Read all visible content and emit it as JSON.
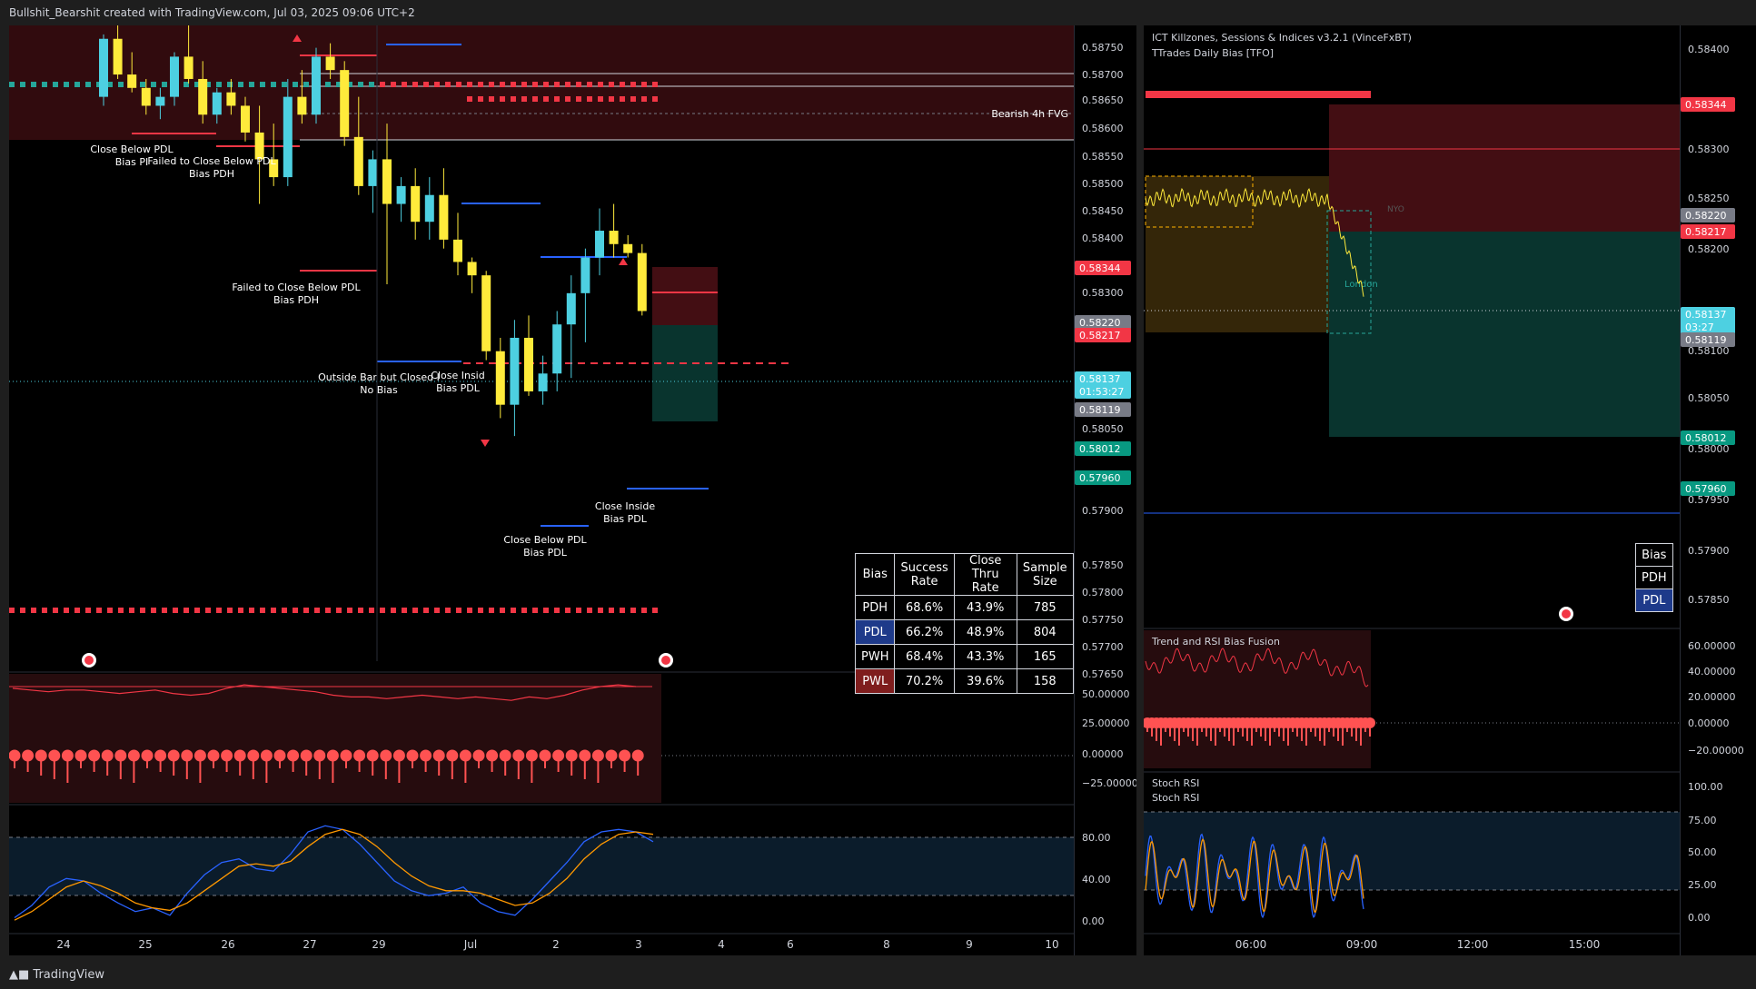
{
  "header": {
    "attribution": "Bullshit_Bearshit created with TradingView.com, Jul 03, 2025 09:06 UTC+2"
  },
  "footer": {
    "brand": "TradingView"
  },
  "colors": {
    "bull": "#4dd0e1",
    "bear": "#ffeb3b",
    "red": "#f44336",
    "green": "#089981",
    "blue": "#2962ff",
    "orange": "#ff9800"
  },
  "left_chart": {
    "price_labels": [
      "0.58750",
      "0.58700",
      "0.58650",
      "0.58600",
      "0.58550",
      "0.58500",
      "0.58450",
      "0.58400",
      "0.58300",
      "0.58050",
      "0.57900",
      "0.57850",
      "0.57800",
      "0.57750",
      "0.57700",
      "0.57650"
    ],
    "price_badges": [
      {
        "text": "0.58344",
        "color": "#f23645"
      },
      {
        "text": "0.58220",
        "color": "#787b86"
      },
      {
        "text": "0.58217",
        "color": "#f23645"
      },
      {
        "text": "0.58137",
        "text2": "01:53:27",
        "color": "#4dd0e1"
      },
      {
        "text": "0.58119",
        "color": "#787b86"
      },
      {
        "text": "0.58012",
        "color": "#089981"
      },
      {
        "text": "0.57960",
        "color": "#089981"
      }
    ],
    "time_labels": [
      "24",
      "25",
      "26",
      "27",
      "29",
      "Jul",
      "2",
      "3",
      "4",
      "6",
      "8",
      "9",
      "10"
    ],
    "annotations": [
      {
        "line1": "Close Below PDL",
        "line2": "Bias PI"
      },
      {
        "line1": "Failed to Close Below PDL",
        "line2": "Bias PDH"
      },
      {
        "line1": "Failed to Close Below PDL",
        "line2": "Bias PDH"
      },
      {
        "line1": "Outside Bar but Closed I",
        "line2": "No Bias"
      },
      {
        "line1": "Close Insid",
        "line2": "Bias PDL"
      },
      {
        "line1": "Close Below PDL",
        "line2": "Bias PDL"
      },
      {
        "line1": "Close Inside",
        "line2": "Bias PDL"
      }
    ],
    "fvg_label": "Bearish 4h FVG",
    "osc1_labels": [
      "50.00000",
      "25.00000",
      "0.00000",
      "−25.00000"
    ],
    "osc2_labels": [
      "80.00",
      "40.00",
      "0.00"
    ]
  },
  "stats_table": {
    "headers": [
      "Bias",
      "Success Rate",
      "Close Thru Rate",
      "Sample Size"
    ],
    "rows": [
      {
        "bias": "PDH",
        "success": "68.6%",
        "close_thru": "43.9%",
        "size": "785",
        "bg": "#000000"
      },
      {
        "bias": "PDL",
        "success": "66.2%",
        "close_thru": "48.9%",
        "size": "804",
        "bg": "#1e3a8a"
      },
      {
        "bias": "PWH",
        "success": "68.4%",
        "close_thru": "43.3%",
        "size": "165",
        "bg": "#000000"
      },
      {
        "bias": "PWL",
        "success": "70.2%",
        "close_thru": "39.6%",
        "size": "158",
        "bg": "#7f1d1d"
      }
    ]
  },
  "right_chart": {
    "legend": [
      "ICT Killzones, Sessions & Indices v3.2.1 (VinceFxBT)",
      "TTrades Daily Bias [TFO]"
    ],
    "price_labels": [
      "0.58400",
      "0.58300",
      "0.58250",
      "0.58200",
      "0.58100",
      "0.58050",
      "0.58000",
      "0.57950",
      "0.57900",
      "0.57850"
    ],
    "price_badges": [
      {
        "text": "0.58344",
        "color": "#f23645"
      },
      {
        "text": "0.58220",
        "color": "#787b86"
      },
      {
        "text": "0.58217",
        "color": "#f23645"
      },
      {
        "text": "0.58137",
        "text2": "03:27",
        "color": "#4dd0e1"
      },
      {
        "text": "0.58119",
        "color": "#787b86"
      },
      {
        "text": "0.58012",
        "color": "#089981"
      },
      {
        "text": "0.57960",
        "color": "#089981"
      }
    ],
    "time_labels": [
      "06:00",
      "09:00",
      "12:00",
      "15:00"
    ],
    "session_labels": [
      "NYO",
      "London"
    ],
    "bias_table": [
      "Bias",
      "PDH",
      "PDL"
    ],
    "osc1_title": "Trend and RSI Bias Fusion",
    "osc1_labels": [
      "60.00000",
      "40.00000",
      "20.00000",
      "0.00000",
      "−20.00000"
    ],
    "osc2_title1": "Stoch RSI",
    "osc2_title2": "Stoch RSI",
    "osc2_labels": [
      "100.00",
      "75.00",
      "50.00",
      "25.00",
      "0.00"
    ]
  },
  "chart_data": {
    "type": "candlestick",
    "title": "",
    "symbol_context": "ICT Killzones, Sessions & Indices v3.2.1 (VinceFxBT); TTrades Daily Bias [TFO]",
    "ylim": [
      0.5762,
      0.5878
    ],
    "x": [
      "24",
      "25",
      "26",
      "27",
      "29",
      "Jul",
      "2",
      "3"
    ],
    "levels": {
      "pdh": 0.58344,
      "current": 0.58137,
      "pdl_mark": 0.58119,
      "target_high": 0.5822,
      "stop": 0.58217,
      "tp1": 0.58012,
      "tp2": 0.5796
    },
    "candles": [
      [
        0.5862,
        0.5876,
        0.586,
        0.5875
      ],
      [
        0.5875,
        0.5878,
        0.5866,
        0.5867
      ],
      [
        0.5867,
        0.5872,
        0.5863,
        0.5864
      ],
      [
        0.5864,
        0.5866,
        0.5858,
        0.586
      ],
      [
        0.586,
        0.5864,
        0.5857,
        0.5862
      ],
      [
        0.5862,
        0.5872,
        0.586,
        0.5871
      ],
      [
        0.5871,
        0.5878,
        0.5865,
        0.5866
      ],
      [
        0.5866,
        0.587,
        0.5856,
        0.5858
      ],
      [
        0.5858,
        0.5864,
        0.5856,
        0.5863
      ],
      [
        0.5863,
        0.5866,
        0.5858,
        0.586
      ],
      [
        0.586,
        0.5862,
        0.5852,
        0.5854
      ],
      [
        0.5854,
        0.586,
        0.5838,
        0.5848
      ],
      [
        0.5848,
        0.5856,
        0.5842,
        0.5844
      ],
      [
        0.5844,
        0.5866,
        0.5842,
        0.5862
      ],
      [
        0.5862,
        0.5868,
        0.5856,
        0.5858
      ],
      [
        0.5858,
        0.5873,
        0.5856,
        0.5871
      ],
      [
        0.5871,
        0.5874,
        0.5866,
        0.5868
      ],
      [
        0.5868,
        0.587,
        0.5851,
        0.5853
      ],
      [
        0.5853,
        0.5862,
        0.584,
        0.5842
      ],
      [
        0.5842,
        0.585,
        0.5836,
        0.5848
      ],
      [
        0.5848,
        0.5856,
        0.582,
        0.5838
      ],
      [
        0.5838,
        0.5844,
        0.5834,
        0.5842
      ],
      [
        0.5842,
        0.5846,
        0.583,
        0.5834
      ],
      [
        0.5834,
        0.5844,
        0.583,
        0.584
      ],
      [
        0.584,
        0.5846,
        0.5828,
        0.583
      ],
      [
        0.583,
        0.5836,
        0.5822,
        0.5825
      ],
      [
        0.5825,
        0.5826,
        0.5818,
        0.5822
      ],
      [
        0.5822,
        0.5823,
        0.5803,
        0.5805
      ],
      [
        0.5805,
        0.5808,
        0.579,
        0.5793
      ],
      [
        0.5793,
        0.5812,
        0.5786,
        0.5808
      ],
      [
        0.5808,
        0.5813,
        0.5795,
        0.5796
      ],
      [
        0.5796,
        0.5804,
        0.5793,
        0.58
      ],
      [
        0.58,
        0.5814,
        0.5796,
        0.5811
      ],
      [
        0.5811,
        0.5822,
        0.5799,
        0.5818
      ],
      [
        0.5818,
        0.5828,
        0.5807,
        0.5826
      ],
      [
        0.5826,
        0.5837,
        0.5822,
        0.5832
      ],
      [
        0.5832,
        0.5838,
        0.5826,
        0.5829
      ],
      [
        0.5829,
        0.5831,
        0.5826,
        0.5827
      ],
      [
        0.5827,
        0.5829,
        0.5813,
        0.5814
      ]
    ],
    "osc1": [
      39,
      38,
      37,
      38,
      38,
      37,
      36,
      37,
      38,
      36,
      35,
      36,
      39,
      41,
      40,
      39,
      38,
      37,
      35,
      34,
      34,
      33,
      34,
      35,
      34,
      33,
      34,
      33,
      32,
      34,
      33,
      35,
      38,
      40,
      41,
      40
    ],
    "stoch_k": [
      10,
      20,
      35,
      42,
      40,
      30,
      22,
      15,
      18,
      12,
      30,
      45,
      55,
      58,
      50,
      48,
      62,
      80,
      85,
      82,
      70,
      55,
      40,
      32,
      28,
      30,
      35,
      22,
      15,
      12,
      25,
      40,
      55,
      72,
      80,
      82,
      80,
      72
    ],
    "stoch_d": [
      8,
      15,
      25,
      35,
      40,
      36,
      30,
      22,
      18,
      16,
      22,
      32,
      42,
      52,
      54,
      52,
      56,
      68,
      78,
      82,
      78,
      68,
      55,
      44,
      36,
      32,
      32,
      30,
      25,
      20,
      22,
      30,
      42,
      58,
      70,
      78,
      80,
      78
    ]
  }
}
